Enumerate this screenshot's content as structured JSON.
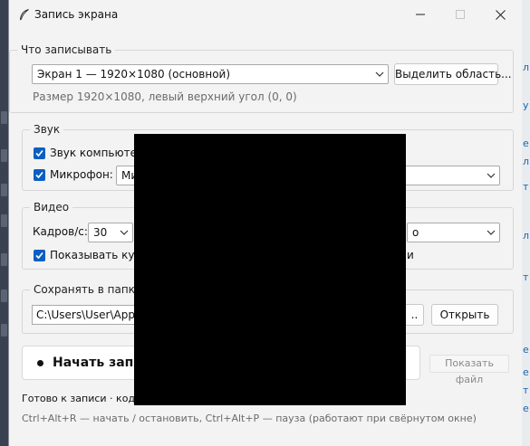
{
  "window": {
    "title": "Запись экрана"
  },
  "source_group": {
    "legend": "Что записывать",
    "screen_select": "Экран 1 — 1920×1080 (основной)",
    "select_area_button": "Выделить область...",
    "size_info": "Размер 1920×1080, левый верхний угол (0, 0)"
  },
  "sound_group": {
    "legend": "Звук",
    "system_audio_label": "Звук компьютера",
    "system_audio_checked": true,
    "mic_label": "Микрофон:",
    "mic_checked": true,
    "mic_select": "Ми"
  },
  "video_group": {
    "legend": "Видео",
    "fps_label": "Кадров/с:",
    "fps_value": "30",
    "right_select_tail": "о",
    "show_cursor_label": "Показывать курс",
    "show_cursor_checked": true,
    "row_tail": "и"
  },
  "save_group": {
    "legend": "Сохранять в папку",
    "path": "C:\\Users\\User\\AppDa",
    "browse_tail": "..",
    "open_button": "Открыть"
  },
  "actions": {
    "record_label": "Начать запис",
    "show_file_button": "Показать файл"
  },
  "status": {
    "text": "Готово к записи · коди",
    "hotkeys": "Ctrl+Alt+R — начать / остановить,  Ctrl+Alt+P — пауза (работают при свёрнутом окне)"
  },
  "background": {
    "right_edge_chars": [
      "л",
      "у",
      "е",
      "л",
      "т",
      "ли",
      "т",
      "е",
      "е",
      "т",
      "е"
    ]
  },
  "colors": {
    "accent": "#0a5fc4",
    "window_bg": "#f3f3f3",
    "blackout": "#000000"
  }
}
